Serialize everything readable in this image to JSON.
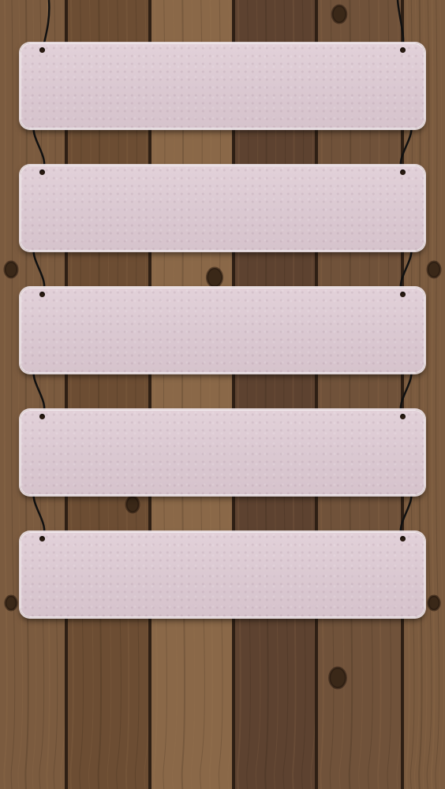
{
  "wallpaper": {
    "wood_colors": [
      "#7b5b3f",
      "#6c4d33",
      "#8a6848",
      "#5d4230",
      "#70523a"
    ],
    "board_color": "#dccbd3",
    "string_color": "#111111",
    "shelf_count": 5
  }
}
